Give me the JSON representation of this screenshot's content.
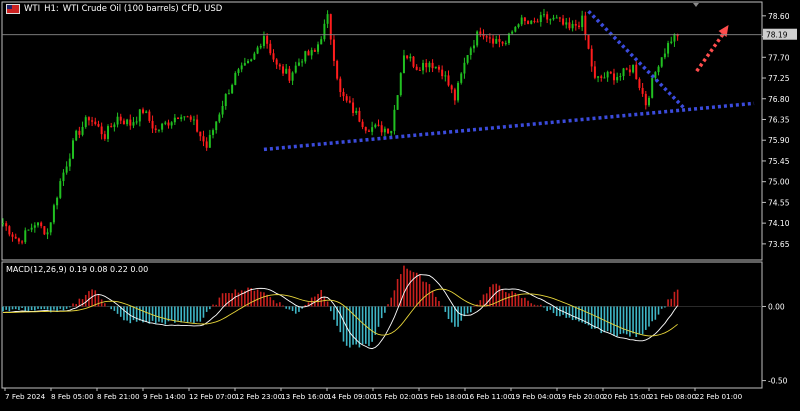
{
  "header": {
    "symbol": "WTI",
    "timeframe": "H1:",
    "description": "WTI Crude Oil (100 barrels) CFD, USD"
  },
  "price_label": "78.19",
  "macd_label": "MACD(12,26,9) 0.19 0.08 0.22 0.00",
  "x_labels": [
    "7 Feb 2024",
    "8 Feb 05:00",
    "8 Feb 21:00",
    "9 Feb 14:00",
    "12 Feb 07:00",
    "12 Feb 23:00",
    "13 Feb 16:00",
    "14 Feb 09:00",
    "15 Feb 02:00",
    "15 Feb 18:00",
    "16 Feb 11:00",
    "19 Feb 04:00",
    "19 Feb 20:00",
    "20 Feb 15:00",
    "21 Feb 08:00",
    "22 Feb 01:00"
  ],
  "colors": {
    "bull": "#21c021",
    "bear": "#ff1d1d",
    "trendline": "#3b4bdc",
    "arrow": "#ff4d4d",
    "macd_pos": "#c8201e",
    "macd_neg": "#3fb6c6",
    "macd_line": "#ffffff",
    "signal_line": "#e8d63a"
  },
  "chart_data": [
    {
      "type": "candlestick",
      "title": "WTI, H1: WTI Crude Oil (100 barrels) CFD, USD",
      "yticks": [
        "78.60",
        "78.15",
        "77.70",
        "77.25",
        "76.80",
        "76.35",
        "75.90",
        "75.45",
        "75.00",
        "74.55",
        "74.10",
        "73.65"
      ],
      "ylim": [
        73.3,
        78.9
      ],
      "current_price": 78.19,
      "path": [
        [
          0,
          74.1
        ],
        [
          5,
          73.7
        ],
        [
          10,
          74.1
        ],
        [
          14,
          73.9
        ],
        [
          18,
          75.0
        ],
        [
          23,
          76.0
        ],
        [
          27,
          76.4
        ],
        [
          32,
          76.0
        ],
        [
          36,
          76.4
        ],
        [
          40,
          76.25
        ],
        [
          44,
          76.55
        ],
        [
          48,
          76.1
        ],
        [
          52,
          76.3
        ],
        [
          56,
          76.5
        ],
        [
          60,
          76.25
        ],
        [
          64,
          75.75
        ],
        [
          69,
          76.7
        ],
        [
          73,
          77.3
        ],
        [
          78,
          77.6
        ],
        [
          82,
          78.2
        ],
        [
          86,
          77.5
        ],
        [
          90,
          77.3
        ],
        [
          94,
          77.7
        ],
        [
          98,
          77.8
        ],
        [
          102,
          78.55
        ],
        [
          106,
          76.9
        ],
        [
          110,
          76.55
        ],
        [
          114,
          76.2
        ],
        [
          118,
          76.15
        ],
        [
          122,
          76.15
        ],
        [
          126,
          77.8
        ],
        [
          130,
          77.5
        ],
        [
          134,
          77.6
        ],
        [
          138,
          77.4
        ],
        [
          142,
          76.8
        ],
        [
          146,
          77.8
        ],
        [
          150,
          78.3
        ],
        [
          154,
          78.1
        ],
        [
          158,
          78.0
        ],
        [
          162,
          78.5
        ],
        [
          166,
          78.4
        ],
        [
          170,
          78.55
        ],
        [
          174,
          78.5
        ],
        [
          178,
          78.3
        ],
        [
          182,
          78.5
        ],
        [
          186,
          77.2
        ],
        [
          190,
          77.3
        ],
        [
          194,
          77.3
        ],
        [
          198,
          77.5
        ],
        [
          202,
          76.7
        ],
        [
          206,
          77.6
        ],
        [
          210,
          78.1
        ],
        [
          212,
          78.2
        ]
      ],
      "series": [
        {
          "name": "WTI",
          "trend": "up"
        }
      ],
      "annotations": {
        "support_line": {
          "from": [
            82,
            75.7
          ],
          "to": [
            236,
            76.7
          ]
        },
        "resistance_line": {
          "from": [
            184,
            78.7
          ],
          "to": [
            214,
            76.6
          ]
        },
        "arrow": {
          "from": [
            218,
            77.4
          ],
          "to": [
            228,
            78.4
          ]
        }
      }
    },
    {
      "type": "bar+line",
      "title": "MACD(12,26,9) 0.19 0.08 0.22 0.00",
      "yticks": [
        "0.00",
        "-0.50"
      ],
      "ylim": [
        -0.55,
        0.3
      ],
      "series": [
        {
          "name": "MACD"
        },
        {
          "name": "Signal"
        }
      ],
      "hist": [
        [
          0,
          -0.02
        ],
        [
          20,
          -0.03
        ],
        [
          28,
          0.12
        ],
        [
          38,
          -0.1
        ],
        [
          50,
          -0.11
        ],
        [
          62,
          -0.1
        ],
        [
          70,
          0.1
        ],
        [
          80,
          0.12
        ],
        [
          92,
          -0.05
        ],
        [
          100,
          0.12
        ],
        [
          108,
          -0.28
        ],
        [
          116,
          -0.25
        ],
        [
          126,
          0.28
        ],
        [
          134,
          0.15
        ],
        [
          142,
          -0.15
        ],
        [
          154,
          0.15
        ],
        [
          164,
          0.05
        ],
        [
          174,
          -0.05
        ],
        [
          182,
          -0.12
        ],
        [
          190,
          -0.18
        ],
        [
          200,
          -0.2
        ],
        [
          206,
          -0.05
        ],
        [
          214,
          0.18
        ]
      ]
    }
  ]
}
